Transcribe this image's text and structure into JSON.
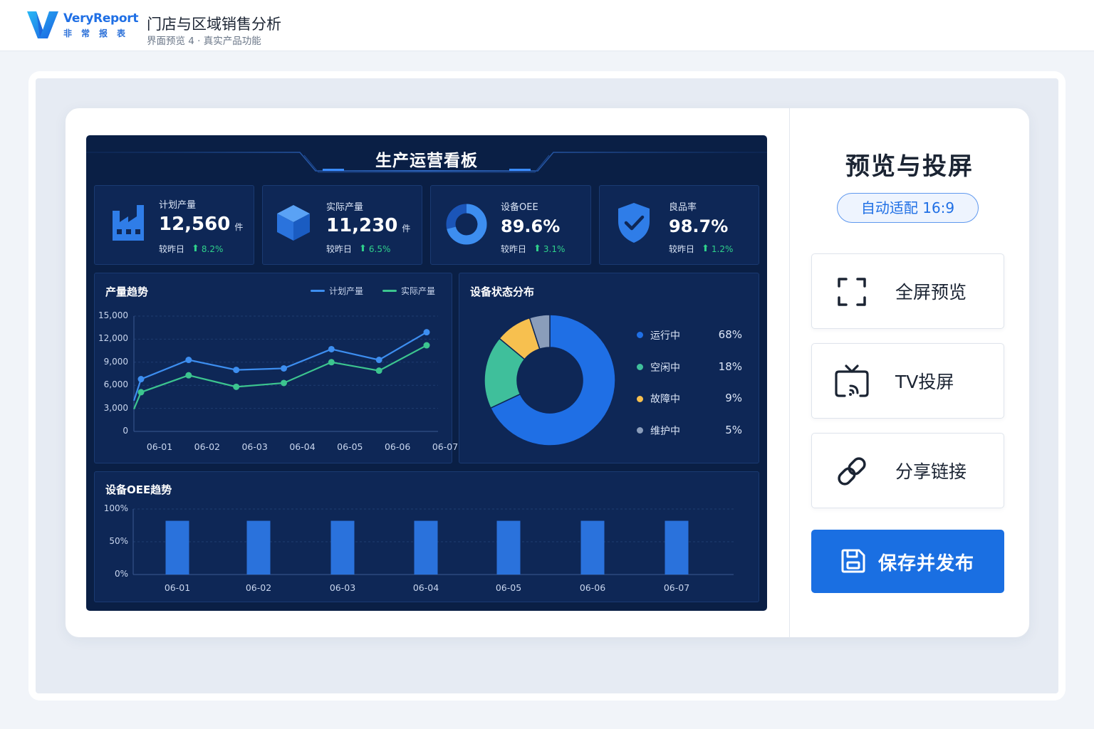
{
  "header": {
    "brand": "VeryReport",
    "brand_sub": "非常报表",
    "title": "门店与区域销售分析",
    "subtitle": "界面预览 4 · 真实产品功能"
  },
  "dashboard": {
    "title": "生产运营看板",
    "kpis": [
      {
        "label": "计划产量",
        "value": "12,560",
        "unit": "件",
        "compare_label": "较昨日",
        "delta": "8.2%",
        "icon": "factory-icon"
      },
      {
        "label": "实际产量",
        "value": "11,230",
        "unit": "件",
        "compare_label": "较昨日",
        "delta": "6.5%",
        "icon": "cube-icon"
      },
      {
        "label": "设备OEE",
        "value": "89.6%",
        "unit": "",
        "compare_label": "较昨日",
        "delta": "3.1%",
        "icon": "ring-icon"
      },
      {
        "label": "良品率",
        "value": "98.7%",
        "unit": "",
        "compare_label": "较昨日",
        "delta": "1.2%",
        "icon": "shield-check-icon"
      }
    ],
    "colors": {
      "background": "#0a1f45",
      "panel": "#0e2756",
      "primary_blue": "#1f6fe5",
      "line_blue": "#3d8ef0",
      "line_green": "#3cc58f",
      "up": "#2fd18b"
    },
    "trend": {
      "title": "产量趋势",
      "legend": [
        "计划产量",
        "实际产量"
      ]
    },
    "status": {
      "title": "设备状态分布",
      "items": [
        {
          "name": "运行中",
          "value": "68%",
          "color": "#1f6fe5"
        },
        {
          "name": "空闲中",
          "value": "18%",
          "color": "#3fbf9b"
        },
        {
          "name": "故障中",
          "value": "9%",
          "color": "#f7c04f"
        },
        {
          "name": "维护中",
          "value": "5%",
          "color": "#8a9dba"
        }
      ]
    },
    "oee": {
      "title": "设备OEE趋势"
    }
  },
  "chart_data": [
    {
      "type": "line",
      "title": "产量趋势",
      "x": [
        "06-01",
        "06-02",
        "06-03",
        "06-04",
        "06-05",
        "06-06",
        "06-07"
      ],
      "y_ticks": [
        "0",
        "3,000",
        "6,000",
        "9,000",
        "12,000",
        "15,000"
      ],
      "ylim": [
        0,
        15000
      ],
      "series": [
        {
          "name": "计划产量",
          "color": "#3d8ef0",
          "values": [
            6800,
            9300,
            8000,
            8200,
            10700,
            9300,
            12900
          ]
        },
        {
          "name": "实际产量",
          "color": "#3cc58f",
          "values": [
            5100,
            7300,
            5800,
            6300,
            9000,
            7900,
            11200
          ]
        }
      ],
      "grid": true,
      "legend_position": "top-right"
    },
    {
      "type": "pie",
      "title": "设备状态分布",
      "categories": [
        "运行中",
        "空闲中",
        "故障中",
        "维护中"
      ],
      "values": [
        68,
        18,
        9,
        5
      ],
      "colors": [
        "#1f6fe5",
        "#3fbf9b",
        "#f7c04f",
        "#8a9dba"
      ],
      "legend_position": "right"
    },
    {
      "type": "bar",
      "title": "设备OEE趋势",
      "categories": [
        "06-01",
        "06-02",
        "06-03",
        "06-04",
        "06-05",
        "06-06",
        "06-07"
      ],
      "values": [
        82,
        82,
        82,
        82,
        82,
        82,
        82
      ],
      "y_ticks": [
        "0%",
        "50%",
        "100%"
      ],
      "ylim": [
        0,
        100
      ],
      "color": "#2a72dc",
      "grid": true
    }
  ],
  "right_panel": {
    "title": "预览与投屏",
    "badge": "自动适配 16:9",
    "buttons": [
      {
        "label": "全屏预览",
        "icon": "fullscreen-icon"
      },
      {
        "label": "TV投屏",
        "icon": "tv-cast-icon"
      },
      {
        "label": "分享链接",
        "icon": "link-icon"
      }
    ],
    "primary": {
      "label": "保存并发布",
      "icon": "save-icon"
    },
    "colors": {
      "primary": "#1a6fe2",
      "badge_border": "#5f98ee"
    }
  }
}
